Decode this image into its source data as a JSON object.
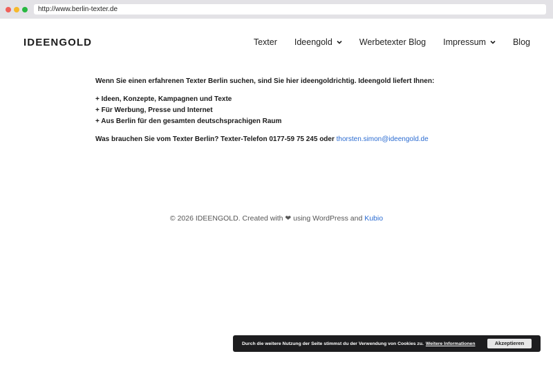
{
  "browser": {
    "url": "http://www.berlin-texter.de"
  },
  "header": {
    "logo": "IDEENGOLD",
    "nav": [
      {
        "label": "Texter",
        "has_dropdown": false
      },
      {
        "label": "Ideengold",
        "has_dropdown": true
      },
      {
        "label": "Werbetexter Blog",
        "has_dropdown": false
      },
      {
        "label": "Impressum",
        "has_dropdown": true
      },
      {
        "label": "Blog",
        "has_dropdown": false
      }
    ]
  },
  "main": {
    "intro": "Wenn Sie einen erfahrenen Texter Berlin suchen, sind Sie hier ideengoldrichtig. Ideengold liefert Ihnen:",
    "bullets": [
      "+ Ideen, Konzepte, Kampagnen und Texte",
      "+ Für Werbung, Presse und Internet",
      "+ Aus Berlin für den gesamten deutschsprachigen Raum"
    ],
    "contact_text": "Was brauchen Sie vom Texter Berlin? Texter-Telefon 0177-59 75 245 oder ",
    "contact_email": "thorsten.simon@ideengold.de"
  },
  "footer": {
    "text": "© 2026 IDEENGOLD. Created with ❤ using WordPress and ",
    "link": "Kubio"
  },
  "cookie_bar": {
    "text": "Durch die weitere Nutzung der Seite stimmst du der Verwendung von Cookies zu.",
    "more_link": "Weitere Informationen",
    "accept_button": "Akzeptieren"
  },
  "colors": {
    "link": "#2a6bd1",
    "cookie_bg": "#1d1d1f",
    "chrome_bg": "#e3e2e6"
  }
}
